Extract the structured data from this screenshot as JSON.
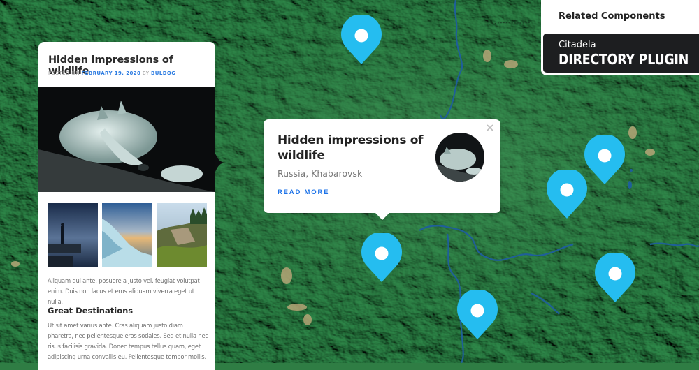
{
  "post": {
    "title": "Hidden impressions of wildlife",
    "meta_prefix": "POSTED ON ",
    "date": "FEBRUARY 19, 2020",
    "meta_by": " BY ",
    "author": "BULDOG",
    "hero_image": "white-wolf-sleeping",
    "gallery": [
      "person-on-rock-at-night",
      "ice-formation-sunset",
      "forest-cliffs"
    ],
    "paragraph1": "Aliquam dui ante, posuere a justo vel, feugiat volutpat enim. Duis non lacus et eros aliquam viverra eget ut nulla.",
    "subheading": "Great Destinations",
    "paragraph2": "Ut sit amet varius ante. Cras aliquam justo diam pharetra, nec pellentesque eros sodales. Sed et nulla nec risus facilisis gravida. Donec tempus tellus quam, eget adipiscing urna convallis eu. Pellentesque tempor mollis."
  },
  "popup": {
    "title": "Hidden impressions of wildlife",
    "location": "Russia, Khabarovsk",
    "read_more": "READ MORE",
    "close_icon": "close-icon",
    "avatar": "white-wolf-thumbnail"
  },
  "related": {
    "title": "Related Components",
    "badge_small": "Citadela",
    "badge_big": "DIRECTORY PLUGIN"
  },
  "map": {
    "style": "terrain",
    "pin_color": "#25bdf0",
    "pin_count": 6
  },
  "colors": {
    "accent_link": "#2f7de1",
    "read_more": "#1e73e8",
    "badge_bg": "#1d1e20"
  }
}
